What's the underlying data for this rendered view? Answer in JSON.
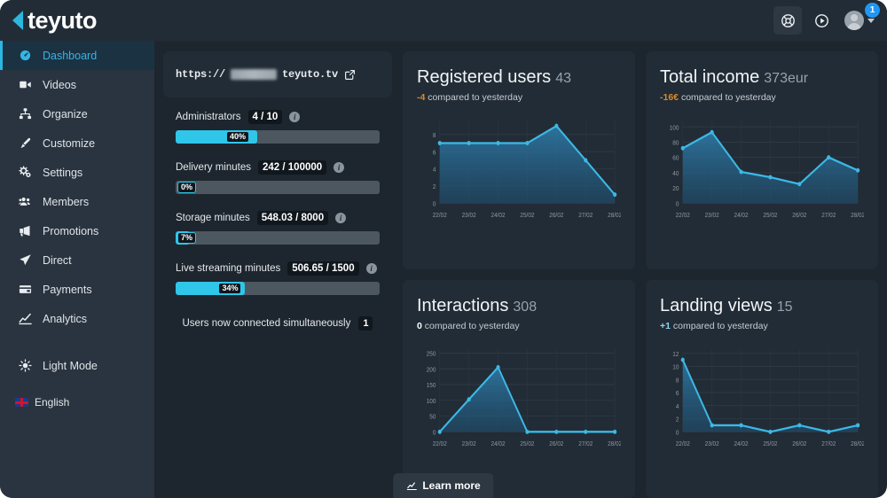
{
  "header": {
    "logo_text": "teyuto",
    "help_icon": "life-ring-icon",
    "video_icon": "play-circle-icon",
    "notification_count": "1"
  },
  "sidebar": {
    "items": [
      {
        "label": "Dashboard",
        "icon": "gauge-icon",
        "active": true
      },
      {
        "label": "Videos",
        "icon": "video-icon",
        "active": false
      },
      {
        "label": "Organize",
        "icon": "sitemap-icon",
        "active": false
      },
      {
        "label": "Customize",
        "icon": "brush-icon",
        "active": false
      },
      {
        "label": "Settings",
        "icon": "gears-icon",
        "active": false
      },
      {
        "label": "Members",
        "icon": "users-icon",
        "active": false
      },
      {
        "label": "Promotions",
        "icon": "megaphone-icon",
        "active": false
      },
      {
        "label": "Direct",
        "icon": "paper-plane-icon",
        "active": false
      },
      {
        "label": "Payments",
        "icon": "card-icon",
        "active": false
      },
      {
        "label": "Analytics",
        "icon": "chart-line-icon",
        "active": false
      }
    ],
    "light_mode": {
      "label": "Light Mode",
      "icon": "sun-icon"
    },
    "language": {
      "label": "English",
      "icon": "uk-flag-icon"
    }
  },
  "site": {
    "url_prefix": "https://",
    "url_suffix": "teyuto.tv",
    "external_link_icon": "external-link-icon"
  },
  "quotas": [
    {
      "label": "Administrators",
      "value": "4 / 10",
      "percent": 40,
      "percent_label": "40%"
    },
    {
      "label": "Delivery minutes",
      "value": "242 / 100000",
      "percent": 0,
      "percent_label": "0%"
    },
    {
      "label": "Storage minutes",
      "value": "548.03 / 8000",
      "percent": 7,
      "percent_label": "7%"
    },
    {
      "label": "Live streaming minutes",
      "value": "506.65 / 1500",
      "percent": 34,
      "percent_label": "34%"
    }
  ],
  "connected": {
    "label": "Users now connected simultaneously",
    "value": "1"
  },
  "footer": {
    "learn_more_label": "Learn more",
    "learn_more_icon": "chart-icon"
  },
  "colors": {
    "accent": "#2fc6ea",
    "line": "#3cb9e6",
    "bg": "#1d262e",
    "card": "#222c36",
    "sidebar": "#2a3440",
    "negative": "#d98b2b",
    "positive": "#8fd4ef"
  },
  "chart_data": [
    {
      "type": "area",
      "title": "Registered users",
      "total": "43",
      "delta": "-4",
      "delta_sign": "neg",
      "delta_text": "compared to yesterday",
      "categories": [
        "22/02",
        "23/02",
        "24/02",
        "25/02",
        "26/02",
        "27/02",
        "28/02"
      ],
      "values": [
        7,
        7,
        7,
        7,
        9,
        5,
        1
      ],
      "yticks": [
        0,
        2,
        4,
        6,
        8
      ],
      "ylim": [
        0,
        9.6
      ],
      "xlabel": "",
      "ylabel": "",
      "grid": true,
      "legend": "none"
    },
    {
      "type": "area",
      "title": "Total income",
      "total": "373eur",
      "delta": "-16€",
      "delta_sign": "neg",
      "delta_text": "compared to yesterday",
      "categories": [
        "22/02",
        "23/02",
        "24/02",
        "25/02",
        "26/02",
        "27/02",
        "28/02"
      ],
      "values": [
        72,
        93,
        41,
        34,
        25,
        60,
        43
      ],
      "yticks": [
        0,
        20,
        40,
        60,
        80,
        100
      ],
      "ylim": [
        0,
        108
      ],
      "xlabel": "",
      "ylabel": "",
      "grid": true,
      "legend": "none"
    },
    {
      "type": "area",
      "title": "Interactions",
      "total": "308",
      "delta": "0",
      "delta_sign": "zero",
      "delta_text": "compared to yesterday",
      "categories": [
        "22/02",
        "23/02",
        "24/02",
        "25/02",
        "26/02",
        "27/02",
        "28/02"
      ],
      "values": [
        0,
        103,
        205,
        0,
        0,
        0,
        0
      ],
      "yticks": [
        0,
        50,
        100,
        150,
        200,
        250
      ],
      "ylim": [
        0,
        262
      ],
      "xlabel": "",
      "ylabel": "",
      "grid": true,
      "legend": "none"
    },
    {
      "type": "area",
      "title": "Landing views",
      "total": "15",
      "delta": "+1",
      "delta_sign": "pos",
      "delta_text": "compared to yesterday",
      "categories": [
        "22/02",
        "23/02",
        "24/02",
        "25/02",
        "26/02",
        "27/02",
        "28/02"
      ],
      "values": [
        11,
        1,
        1,
        0,
        1,
        0,
        1
      ],
      "yticks": [
        0,
        2,
        4,
        6,
        8,
        10,
        12
      ],
      "ylim": [
        0,
        12.6
      ],
      "xlabel": "",
      "ylabel": "",
      "grid": true,
      "legend": "none"
    }
  ]
}
